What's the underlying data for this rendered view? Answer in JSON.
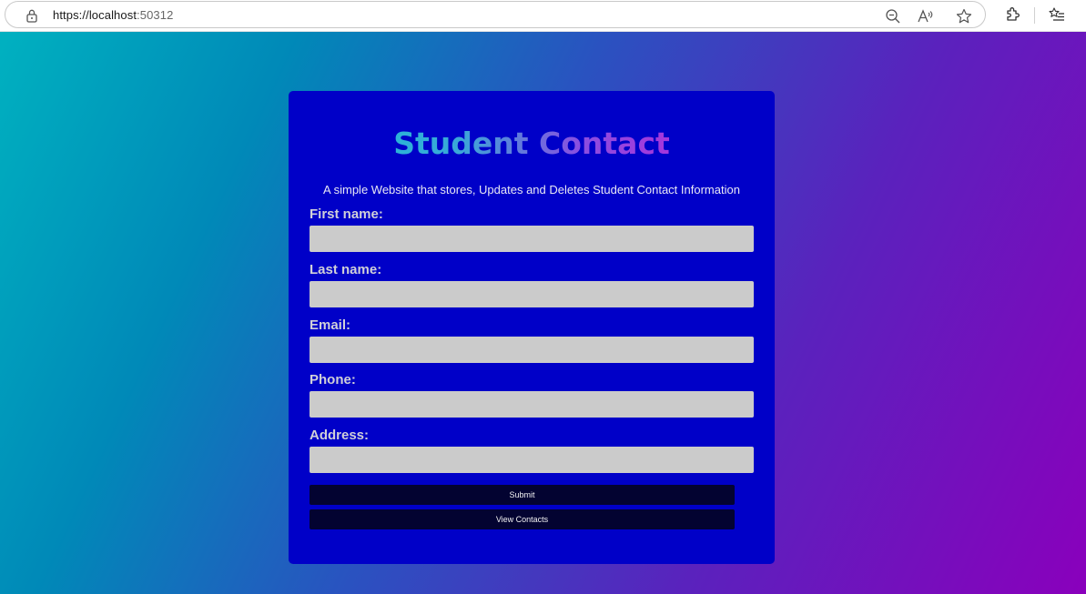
{
  "browser": {
    "url_scheme_host": "https://localhost",
    "url_port": ":50312",
    "icons": [
      "lock-icon",
      "zoom-out-icon",
      "read-aloud-icon",
      "favorite-star-icon",
      "extensions-icon",
      "favorites-list-icon"
    ]
  },
  "form": {
    "title": "Student Contact",
    "subtitle": "A simple Website that stores, Updates and Deletes Student Contact Information",
    "fields": [
      {
        "label": "First name:",
        "value": ""
      },
      {
        "label": "Last name:",
        "value": ""
      },
      {
        "label": "Email:",
        "value": ""
      },
      {
        "label": "Phone:",
        "value": ""
      },
      {
        "label": "Address:",
        "value": ""
      }
    ],
    "submit_label": "Submit",
    "view_contacts_label": "View Contacts"
  },
  "colors": {
    "card_background": "#0000c8",
    "input_background": "#cbcbcb",
    "button_background": "#030331",
    "title_gradient_start": "#14c4d6",
    "title_gradient_end": "#c61ad6",
    "page_gradient_start": "#00b1c0",
    "page_gradient_end": "#8a00bc"
  }
}
